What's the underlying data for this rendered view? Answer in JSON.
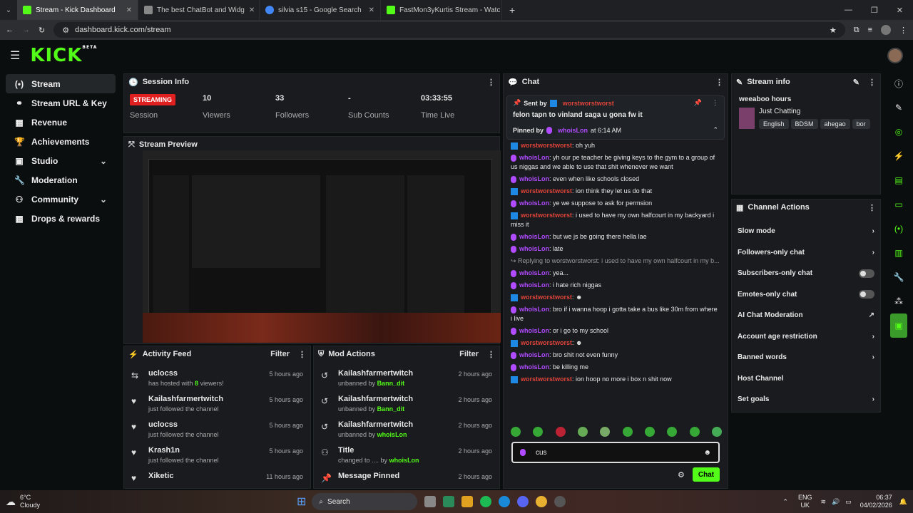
{
  "browser": {
    "tabs": [
      {
        "title": "Stream - Kick Dashboard",
        "color": "#53fc18"
      },
      {
        "title": "The best ChatBot and Widg",
        "color": "#888888"
      },
      {
        "title": "silvia s15 - Google Search",
        "color": "#4285f4"
      },
      {
        "title": "FastMon3yKurtis Stream - Watc",
        "color": "#53fc18"
      }
    ],
    "url": "dashboard.kick.com/stream"
  },
  "app": {
    "logo": "KICK",
    "logo_sup": "BETA"
  },
  "nav": {
    "items": [
      {
        "label": "Stream",
        "icon": "(•)"
      },
      {
        "label": "Stream URL & Key",
        "icon": "⚭"
      },
      {
        "label": "Revenue",
        "icon": "▦"
      },
      {
        "label": "Achievements",
        "icon": "🏆"
      },
      {
        "label": "Studio",
        "icon": "▣",
        "chev": "⌄"
      },
      {
        "label": "Moderation",
        "icon": "🔧"
      },
      {
        "label": "Community",
        "icon": "⚇",
        "chev": "⌄"
      },
      {
        "label": "Drops & rewards",
        "icon": "▦"
      }
    ]
  },
  "session": {
    "title": "Session Info",
    "status": "STREAMING",
    "status_label": "Session",
    "stats": [
      {
        "value": "10",
        "label": "Viewers"
      },
      {
        "value": "33",
        "label": "Followers"
      },
      {
        "value": "-",
        "label": "Sub Counts"
      },
      {
        "value": "03:33:55",
        "label": "Time Live"
      }
    ]
  },
  "preview": {
    "title": "Stream Preview"
  },
  "activity": {
    "title": "Activity Feed",
    "filter": "Filter",
    "items": [
      {
        "name": "uclocss",
        "sub_pre": "has hosted with ",
        "sub_num": "8",
        "sub_post": " viewers!",
        "time": "5 hours ago",
        "icon": "⇆"
      },
      {
        "name": "Kailashfarmertwitch",
        "sub_pre": "just followed the channel",
        "sub_num": "",
        "sub_post": "",
        "time": "5 hours ago",
        "icon": "♥"
      },
      {
        "name": "uclocss",
        "sub_pre": "just followed the channel",
        "sub_num": "",
        "sub_post": "",
        "time": "5 hours ago",
        "icon": "♥"
      },
      {
        "name": "Krash1n",
        "sub_pre": "just followed the channel",
        "sub_num": "",
        "sub_post": "",
        "time": "5 hours ago",
        "icon": "♥"
      },
      {
        "name": "Xiketic",
        "sub_pre": "",
        "sub_num": "",
        "sub_post": "",
        "time": "11 hours ago",
        "icon": "♥"
      }
    ]
  },
  "mod": {
    "title": "Mod Actions",
    "filter": "Filter",
    "items": [
      {
        "name": "Kailashfarmertwitch",
        "sub_pre": "unbanned by ",
        "by": "Bann_dit",
        "time": "2 hours ago",
        "icon": "↺"
      },
      {
        "name": "Kailashfarmertwitch",
        "sub_pre": "unbanned by ",
        "by": "Bann_dit",
        "time": "2 hours ago",
        "icon": "↺"
      },
      {
        "name": "Kailashfarmertwitch",
        "sub_pre": "unbanned by ",
        "by": "whoisLon",
        "time": "2 hours ago",
        "icon": "↺"
      },
      {
        "name": "Title",
        "sub_pre": "changed to .... by ",
        "by": "whoisLon",
        "time": "2 hours ago",
        "icon": "⚇"
      },
      {
        "name": "Message Pinned",
        "sub_pre": "",
        "by": "",
        "time": "2 hours ago",
        "icon": "📌"
      }
    ]
  },
  "chat": {
    "title": "Chat",
    "pinned": {
      "sent_by_label": "Sent by",
      "sent_by": "worstworstworst",
      "message": "felon tapn to vinland saga u gona fw it",
      "pinned_by_label": "Pinned by",
      "pinned_by": "whoisLon",
      "pinned_at": "at 6:14 AM"
    },
    "messages": [
      {
        "user": "worstworstworst",
        "color": "red",
        "text": "oh yuh"
      },
      {
        "user": "whoisLon",
        "color": "purple",
        "text": "yh our pe teacher be giving keys to the gym to a group of us niggas and we able to use that shit whenever we want"
      },
      {
        "user": "whoisLon",
        "color": "purple",
        "text": "even when like schools closed"
      },
      {
        "user": "worstworstworst",
        "color": "red",
        "text": "ion think they let us do that"
      },
      {
        "user": "whoisLon",
        "color": "purple",
        "text": "ye we suppose to ask for permsion"
      },
      {
        "user": "worstworstworst",
        "color": "red",
        "text": "i used to have my own halfcourt in my backyard i miss it"
      },
      {
        "user": "whoisLon",
        "color": "purple",
        "text": "but we js be going there hella lae"
      },
      {
        "user": "whoisLon",
        "color": "purple",
        "text": "late"
      },
      {
        "user": "",
        "color": "grey",
        "text": "Replying to worstworstworst: i used to have my own halfcourt in my b..."
      },
      {
        "user": "whoisLon",
        "color": "purple",
        "text": "yea..."
      },
      {
        "user": "whoisLon",
        "color": "purple",
        "text": "i hate rich niggas"
      },
      {
        "user": "worstworstworst",
        "color": "red",
        "text": "☻"
      },
      {
        "user": "whoisLon",
        "color": "purple",
        "text": "bro if i wanna hoop i gotta take a bus like 30m from where i live"
      },
      {
        "user": "whoisLon",
        "color": "purple",
        "text": "or i go to my school"
      },
      {
        "user": "worstworstworst",
        "color": "red",
        "text": "☻"
      },
      {
        "user": "whoisLon",
        "color": "purple",
        "text": "bro shit not even funny"
      },
      {
        "user": "whoisLon",
        "color": "purple",
        "text": "be killing me"
      },
      {
        "user": "worstworstworst",
        "color": "red",
        "text": "ion hoop no more i box n shit now"
      }
    ],
    "input_value": "cus",
    "send_label": "Chat"
  },
  "stream_info": {
    "title": "Stream info",
    "stream_title": "weeaboo hours",
    "category": "Just Chatting",
    "tags": [
      "English",
      "BDSM",
      "ahegao",
      "bor"
    ]
  },
  "channel_actions": {
    "title": "Channel Actions",
    "items": [
      {
        "label": "Slow mode",
        "ctrl": "chev"
      },
      {
        "label": "Followers-only chat",
        "ctrl": "chev"
      },
      {
        "label": "Subscribers-only chat",
        "ctrl": "toggle"
      },
      {
        "label": "Emotes-only chat",
        "ctrl": "toggle"
      },
      {
        "label": "AI Chat Moderation",
        "ctrl": "ext"
      },
      {
        "label": "Account age restriction",
        "ctrl": "chev"
      },
      {
        "label": "Banned words",
        "ctrl": "chev"
      },
      {
        "label": "Host Channel",
        "ctrl": ""
      },
      {
        "label": "Set goals",
        "ctrl": "chev"
      }
    ]
  },
  "taskbar": {
    "weather_temp": "6°C",
    "weather_desc": "Cloudy",
    "search": "Search",
    "lang": "ENG",
    "region": "UK",
    "time": "06:37",
    "date": "04/02/2026"
  }
}
